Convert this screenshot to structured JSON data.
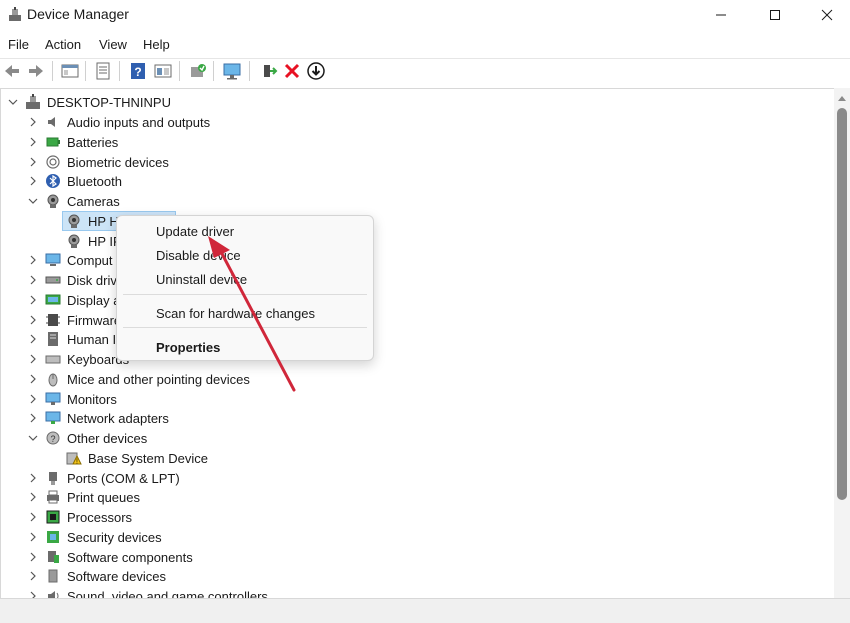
{
  "window": {
    "title": "Device Manager",
    "minimize_glyph": "—",
    "maximize_glyph": "☐",
    "close_glyph": "✕"
  },
  "menu": [
    "File",
    "Action",
    "View",
    "Help"
  ],
  "toolbar": {
    "buttons": [
      "back-icon",
      "forward-icon",
      "show-hide-console-tree-icon",
      "properties-icon",
      "help-icon",
      "view-icon",
      "update-driver-icon",
      "scan-hardware-icon",
      "enable-device-icon",
      "uninstall-device-icon",
      "download-icon"
    ]
  },
  "tree": {
    "root": "DESKTOP-THNINPU",
    "items": [
      {
        "label": "Audio inputs and outputs",
        "icon": "speaker-icon",
        "expanded": false
      },
      {
        "label": "Batteries",
        "icon": "battery-icon",
        "expanded": false
      },
      {
        "label": "Biometric devices",
        "icon": "fingerprint-icon",
        "expanded": false
      },
      {
        "label": "Bluetooth",
        "icon": "bluetooth-icon",
        "expanded": false
      },
      {
        "label": "Cameras",
        "icon": "webcam-icon",
        "expanded": true
      },
      {
        "label": "HP H",
        "icon": "webcam-icon",
        "child": true,
        "selected": true
      },
      {
        "label": "HP IF",
        "icon": "webcam-icon",
        "child": true
      },
      {
        "label": "Comput",
        "icon": "computer-icon",
        "expanded": false
      },
      {
        "label": "Disk driv",
        "icon": "disk-drive-icon",
        "expanded": false
      },
      {
        "label": "Display a",
        "icon": "display-adapter-icon",
        "expanded": false
      },
      {
        "label": "Firmware",
        "icon": "firmware-icon",
        "expanded": false
      },
      {
        "label": "Human I",
        "icon": "hid-icon",
        "expanded": false
      },
      {
        "label": "Keyboards",
        "icon": "keyboard-icon",
        "expanded": false
      },
      {
        "label": "Mice and other pointing devices",
        "icon": "mouse-icon",
        "expanded": false
      },
      {
        "label": "Monitors",
        "icon": "monitor-icon",
        "expanded": false
      },
      {
        "label": "Network adapters",
        "icon": "network-adapter-icon",
        "expanded": false
      },
      {
        "label": "Other devices",
        "icon": "unknown-device-icon",
        "expanded": true
      },
      {
        "label": "Base System Device",
        "icon": "warning-device-icon",
        "child": true
      },
      {
        "label": "Ports (COM & LPT)",
        "icon": "port-icon",
        "expanded": false
      },
      {
        "label": "Print queues",
        "icon": "printer-icon",
        "expanded": false
      },
      {
        "label": "Processors",
        "icon": "processor-icon",
        "expanded": false
      },
      {
        "label": "Security devices",
        "icon": "security-device-icon",
        "expanded": false
      },
      {
        "label": "Software components",
        "icon": "software-component-icon",
        "expanded": false
      },
      {
        "label": "Software devices",
        "icon": "software-device-icon",
        "expanded": false
      },
      {
        "label": "Sound, video and game controllers",
        "icon": "sound-icon",
        "expanded": false
      }
    ]
  },
  "context_menu": {
    "update_driver": "Update driver",
    "disable_device": "Disable device",
    "uninstall_device": "Uninstall device",
    "scan_hardware": "Scan for hardware changes",
    "properties": "Properties"
  },
  "colors": {
    "selection": "#cce4f7",
    "annotation_arrow": "#d0273a",
    "uninstall_red": "#e81123"
  }
}
